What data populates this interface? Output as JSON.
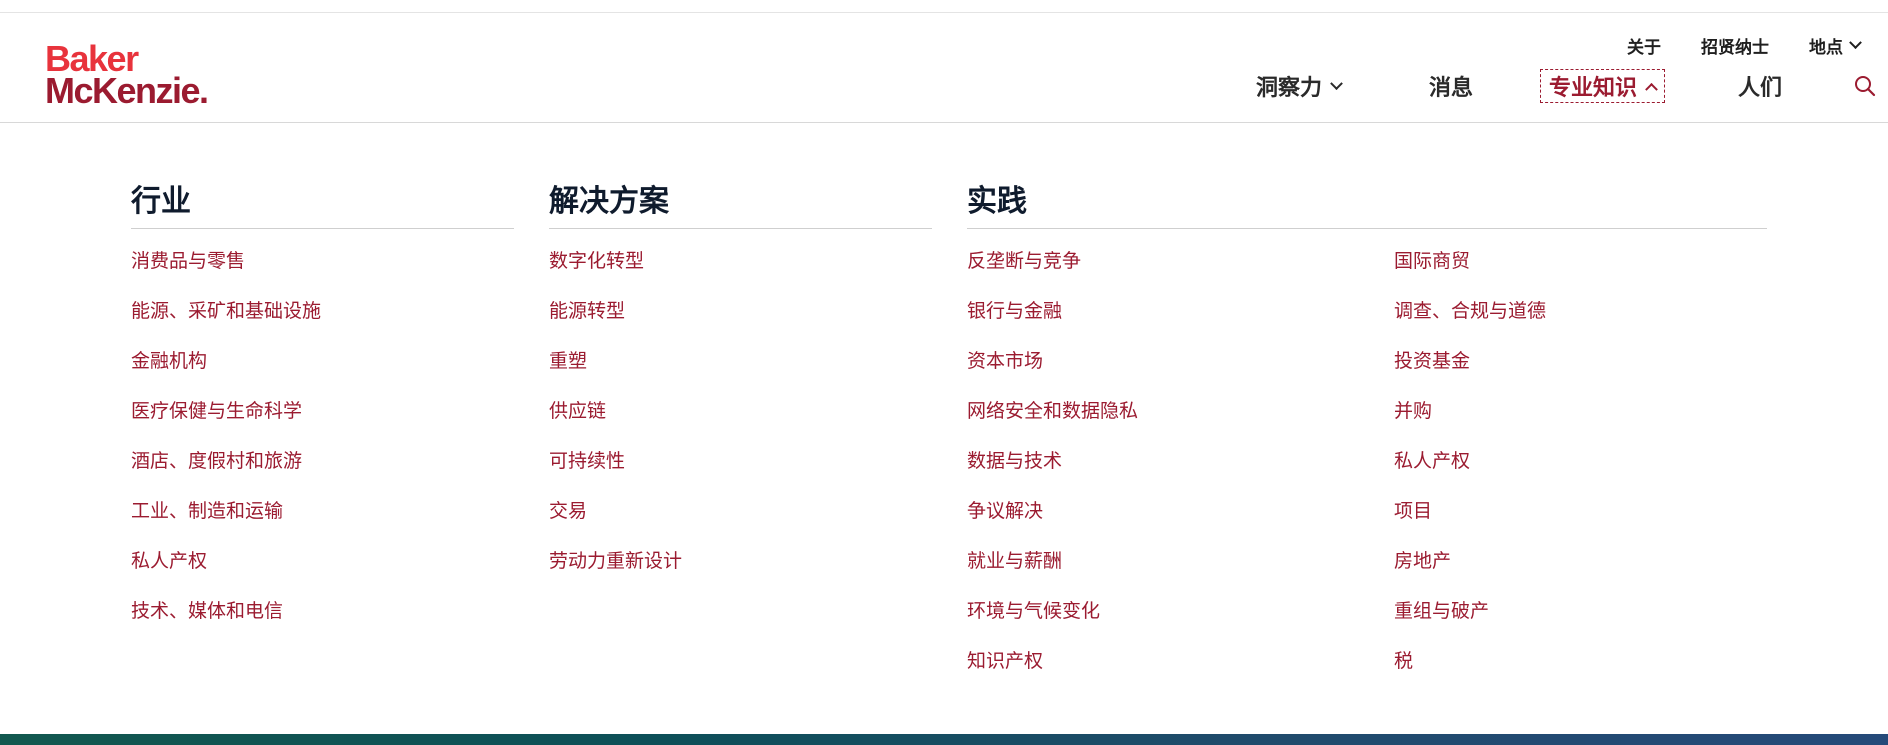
{
  "brand": {
    "line1": "Baker",
    "line2": "McKenzie",
    "dot": "."
  },
  "utility_nav": [
    {
      "label": "关于"
    },
    {
      "label": "招贤纳士"
    },
    {
      "label": "地点"
    }
  ],
  "main_nav": [
    {
      "label": "洞察力"
    },
    {
      "label": "消息"
    },
    {
      "label": "专业知识"
    },
    {
      "label": "人们"
    }
  ],
  "colors": {
    "brand_red": "#9b1b30",
    "logo_red": "#e8333c",
    "heading": "#0f1b2d"
  },
  "icons": {
    "search": "search-icon",
    "chevron_down": "chevron-down-icon",
    "chevron_up": "chevron-up-icon"
  },
  "mega_menu": {
    "industries": {
      "heading": "行业",
      "items": [
        "消费品与零售",
        "能源、采矿和基础设施",
        "金融机构",
        "医疗保健与生命科学",
        "酒店、度假村和旅游",
        "工业、制造和运输",
        "私人产权",
        "技术、媒体和电信"
      ]
    },
    "solutions": {
      "heading": "解决方案",
      "items": [
        "数字化转型",
        "能源转型",
        "重塑",
        "供应链",
        "可持续性",
        "交易",
        "劳动力重新设计"
      ]
    },
    "practices": {
      "heading": "实践",
      "col1": [
        "反垄断与竞争",
        "银行与金融",
        "资本市场",
        "网络安全和数据隐私",
        "数据与技术",
        "争议解决",
        "就业与薪酬",
        "环境与气候变化",
        "知识产权"
      ],
      "col2": [
        "国际商贸",
        "调查、合规与道德",
        "投资基金",
        "并购",
        "私人产权",
        "项目",
        "房地产",
        "重组与破产",
        "税"
      ]
    }
  }
}
